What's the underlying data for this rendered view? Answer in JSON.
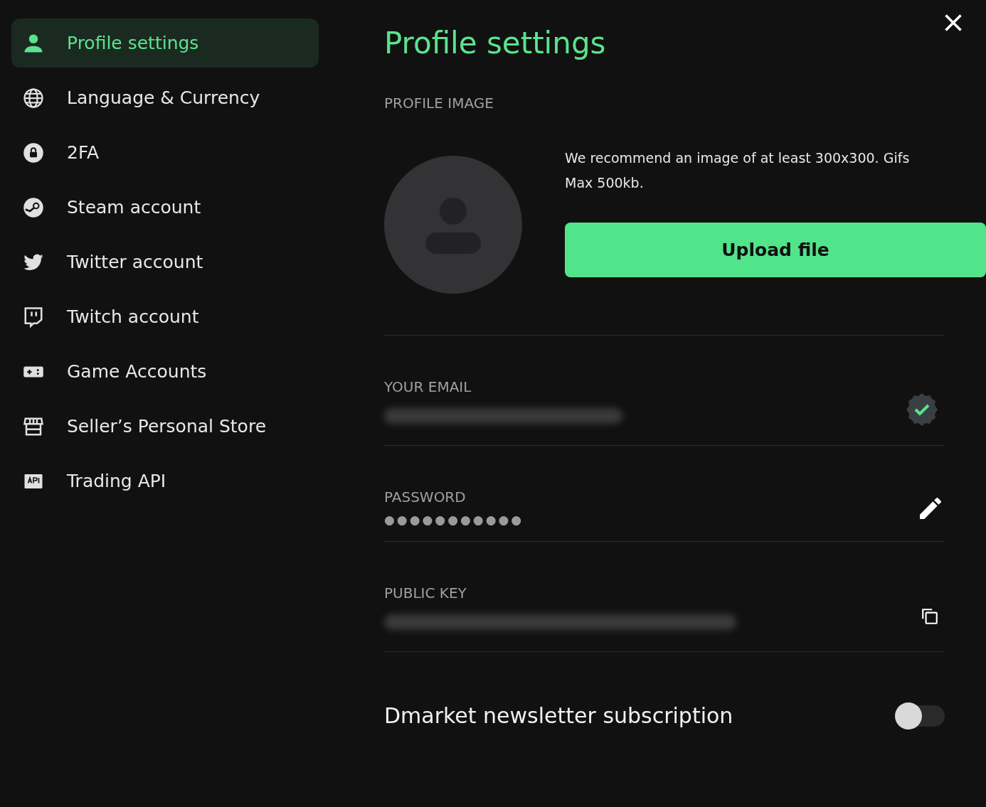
{
  "sidebar": {
    "items": [
      {
        "label": "Profile settings",
        "selected": true
      },
      {
        "label": "Language & Currency",
        "selected": false
      },
      {
        "label": "2FA",
        "selected": false
      },
      {
        "label": "Steam account",
        "selected": false
      },
      {
        "label": "Twitter account",
        "selected": false
      },
      {
        "label": "Twitch account",
        "selected": false
      },
      {
        "label": "Game Accounts",
        "selected": false
      },
      {
        "label": "Seller’s Personal Store",
        "selected": false
      },
      {
        "label": "Trading API",
        "selected": false
      }
    ]
  },
  "title": "Profile settings",
  "profile_image": {
    "label": "PROFILE IMAGE",
    "description": [
      "We recommend an image of at least 300x300. Gifs",
      "Max 500kb."
    ],
    "button": "Upload file"
  },
  "email": {
    "label": "YOUR EMAIL",
    "verified": true
  },
  "password": {
    "label": "PASSWORD",
    "value": "●●●●●●●●●●●"
  },
  "public_key": {
    "label": "PUBLIC KEY"
  },
  "newsletter": {
    "label": "Dmarket newsletter subscription",
    "on": false
  }
}
